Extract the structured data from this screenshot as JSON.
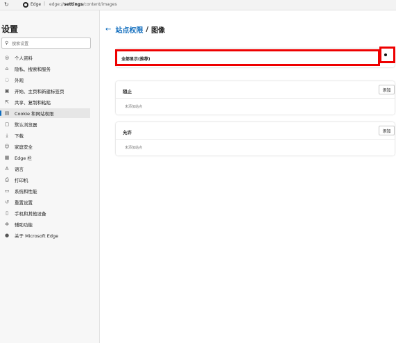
{
  "browser": {
    "site_name": "Edge",
    "separator": "|",
    "url_prefix": "edge://",
    "url_bold": "settings",
    "url_suffix": "/content/images"
  },
  "sidebar": {
    "title": "设置",
    "search_placeholder": "搜索设置",
    "items": [
      {
        "label": "个人资料",
        "icon": "profile-icon"
      },
      {
        "label": "隐私、搜索和服务",
        "icon": "lock-icon"
      },
      {
        "label": "外观",
        "icon": "appearance-icon"
      },
      {
        "label": "开始、主页和新建标签页",
        "icon": "start-page-icon"
      },
      {
        "label": "共享、复制和粘贴",
        "icon": "share-icon"
      },
      {
        "label": "Cookie 和网站权限",
        "icon": "cookie-icon",
        "active": true
      },
      {
        "label": "默认浏览器",
        "icon": "browser-icon"
      },
      {
        "label": "下载",
        "icon": "download-icon"
      },
      {
        "label": "家庭安全",
        "icon": "family-icon"
      },
      {
        "label": "Edge 栏",
        "icon": "edge-bar-icon"
      },
      {
        "label": "语言",
        "icon": "language-icon"
      },
      {
        "label": "打印机",
        "icon": "printer-icon"
      },
      {
        "label": "系统和性能",
        "icon": "system-icon"
      },
      {
        "label": "重置设置",
        "icon": "reset-icon"
      },
      {
        "label": "手机和其他设备",
        "icon": "phone-icon"
      },
      {
        "label": "辅助功能",
        "icon": "accessibility-icon"
      },
      {
        "label": "关于 Microsoft Edge",
        "icon": "edge-logo-icon"
      }
    ]
  },
  "main": {
    "breadcrumb_parent": "站点权限",
    "breadcrumb_separator": "/",
    "breadcrumb_current": "图像",
    "show_all_label": "全部显示(推荐)",
    "show_all_enabled": true,
    "block": {
      "title": "阻止",
      "add_label": "添加",
      "empty_text": "未添加站点"
    },
    "allow": {
      "title": "允许",
      "add_label": "添加",
      "empty_text": "未添加站点"
    }
  },
  "colors": {
    "accent": "#0f6cbd",
    "highlight": "#ee0000"
  }
}
